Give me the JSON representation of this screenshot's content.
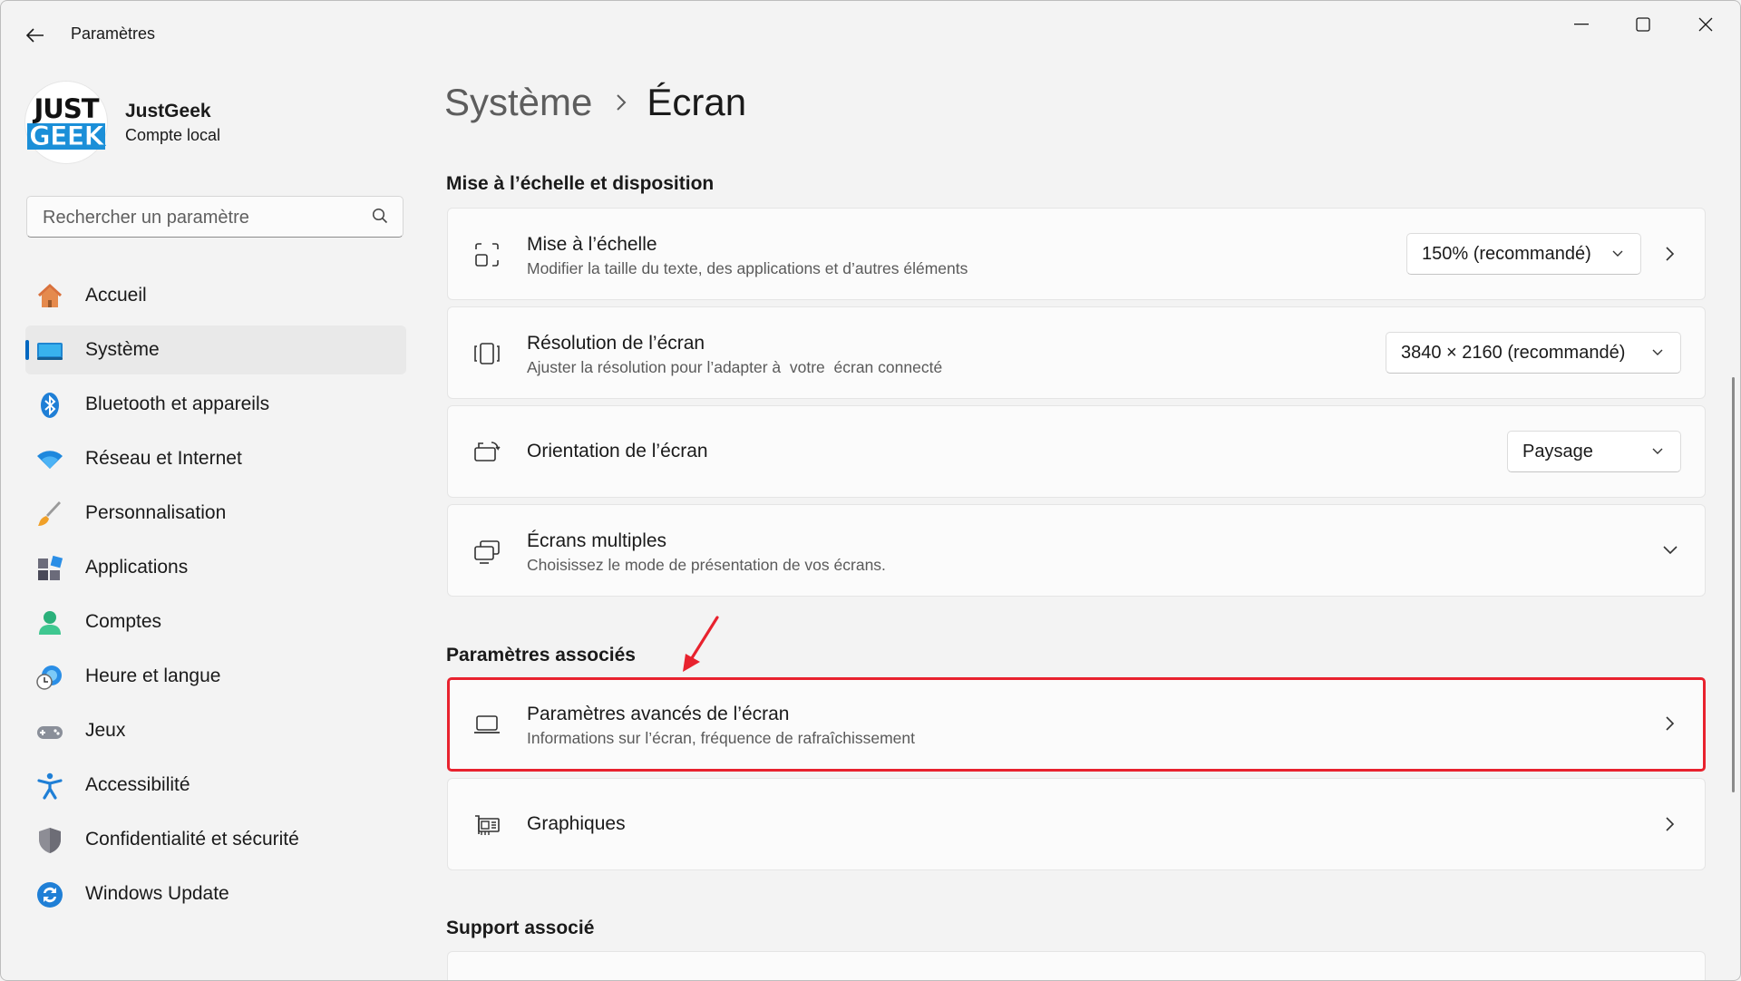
{
  "window": {
    "title": "Paramètres"
  },
  "profile": {
    "logo_top": "JUST",
    "logo_bottom": "GEEK",
    "name": "JustGeek",
    "account_type": "Compte local"
  },
  "search": {
    "placeholder": "Rechercher un paramètre"
  },
  "sidebar": {
    "items": [
      {
        "label": "Accueil",
        "icon": "home-icon"
      },
      {
        "label": "Système",
        "icon": "system-icon",
        "active": true
      },
      {
        "label": "Bluetooth et appareils",
        "icon": "bluetooth-icon"
      },
      {
        "label": "Réseau et Internet",
        "icon": "wifi-icon"
      },
      {
        "label": "Personnalisation",
        "icon": "brush-icon"
      },
      {
        "label": "Applications",
        "icon": "apps-icon"
      },
      {
        "label": "Comptes",
        "icon": "accounts-icon"
      },
      {
        "label": "Heure et langue",
        "icon": "time-language-icon"
      },
      {
        "label": "Jeux",
        "icon": "gamepad-icon"
      },
      {
        "label": "Accessibilité",
        "icon": "accessibility-icon"
      },
      {
        "label": "Confidentialité et sécurité",
        "icon": "shield-icon"
      },
      {
        "label": "Windows Update",
        "icon": "update-icon"
      }
    ]
  },
  "breadcrumb": {
    "parent": "Système",
    "current": "Écran"
  },
  "sections": {
    "scale_layout": "Mise à l’échelle et disposition",
    "related_settings": "Paramètres associés",
    "related_support": "Support associé"
  },
  "cards": {
    "scale": {
      "title": "Mise à l’échelle",
      "subtitle": "Modifier la taille du texte, des applications et d’autres éléments",
      "value": "150% (recommandé)"
    },
    "resolution": {
      "title": "Résolution de l’écran",
      "subtitle": "Ajuster la résolution pour l’adapter à  votre  écran connecté",
      "value": "3840 × 2160 (recommandé)"
    },
    "orientation": {
      "title": "Orientation de l’écran",
      "value": "Paysage"
    },
    "multiple": {
      "title": "Écrans multiples",
      "subtitle": "Choisissez le mode de présentation de vos écrans."
    },
    "advanced": {
      "title": "Paramètres avancés de l’écran",
      "subtitle": "Informations sur l’écran, fréquence de rafraîchissement"
    },
    "graphics": {
      "title": "Graphiques"
    }
  },
  "colors": {
    "accent": "#0067c0",
    "highlight_border": "#e8222e",
    "annotation_arrow": "#e8222e"
  }
}
